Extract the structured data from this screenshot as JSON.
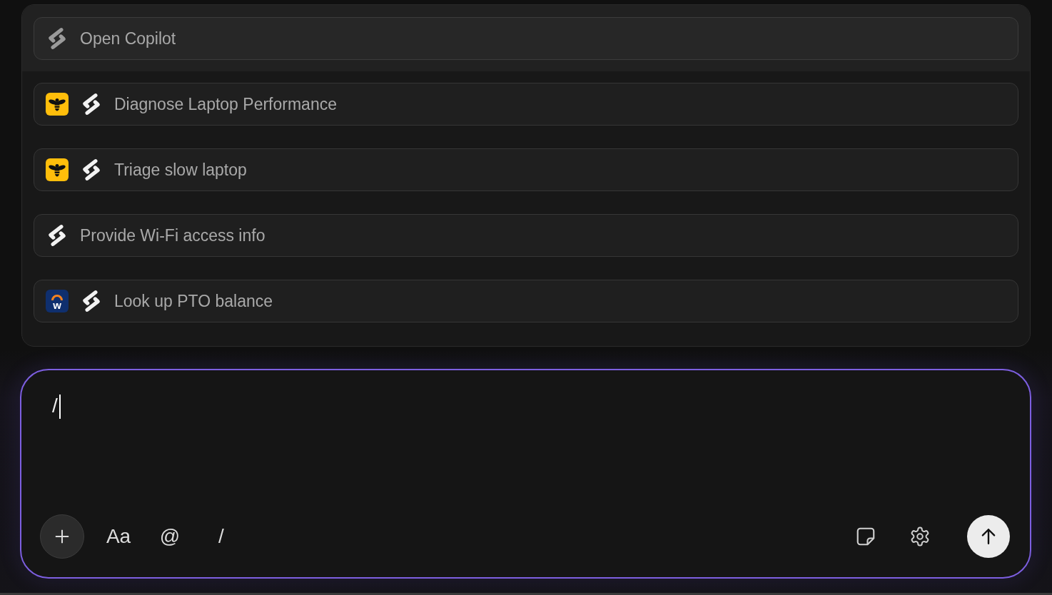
{
  "menu": {
    "items": [
      {
        "label": "Open Copilot",
        "selected": true
      },
      {
        "label": "Diagnose Laptop Performance",
        "selected": false,
        "app": {
          "kind": "bee"
        }
      },
      {
        "label": "Triage slow laptop",
        "selected": false,
        "app": {
          "kind": "bee"
        }
      },
      {
        "label": "Provide Wi-Fi access info",
        "selected": false
      },
      {
        "label": "Look up PTO balance",
        "selected": false,
        "app": {
          "kind": "workday",
          "letter": "w"
        }
      }
    ]
  },
  "composer": {
    "value": "/",
    "focused": true,
    "tools": [
      "Aa",
      "@",
      "/"
    ]
  }
}
